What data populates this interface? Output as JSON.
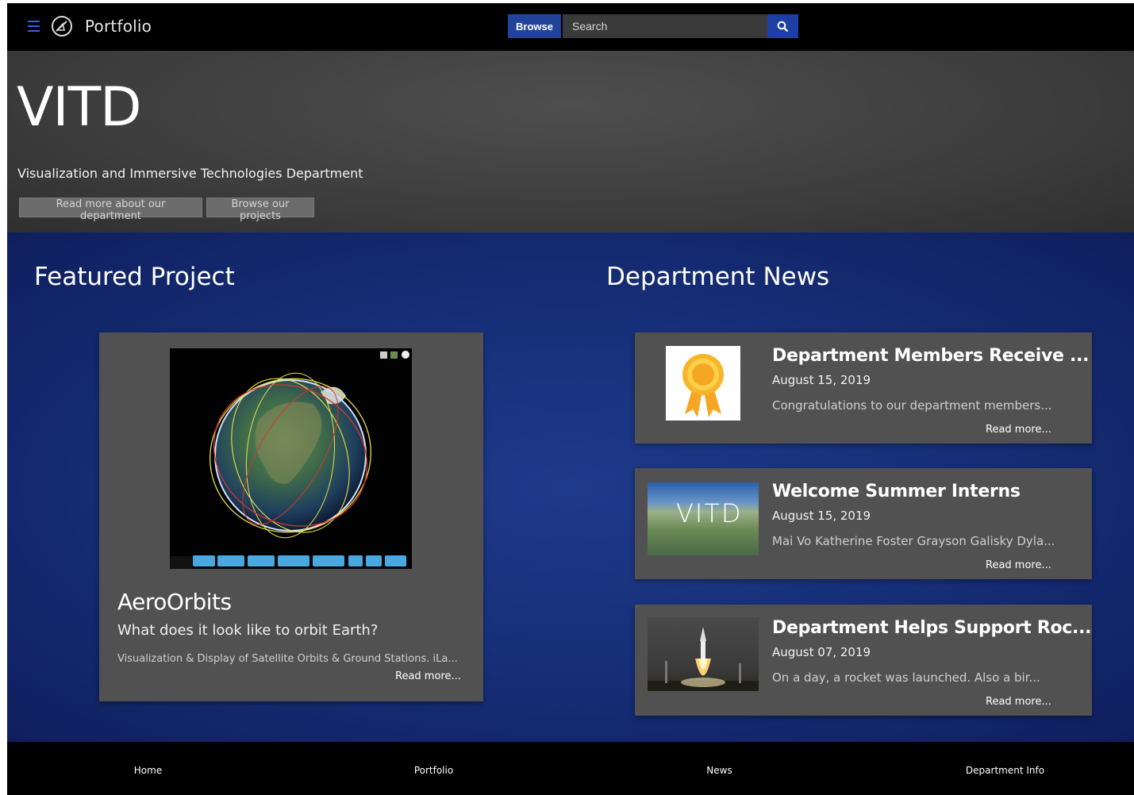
{
  "topbar": {
    "brand": "Portfolio",
    "browse_label": "Browse",
    "search_placeholder": "Search"
  },
  "hero": {
    "title": "VITD",
    "subtitle": "Visualization and Immersive Technologies Department",
    "buttons": [
      "Read more about our department",
      "Browse our projects"
    ]
  },
  "featured": {
    "heading": "Featured Project",
    "name": "AeroOrbits",
    "question": "What does it look like to orbit Earth?",
    "description": "Visualization & Display of Satellite Orbits & Ground Stations. iLa...",
    "read_more": "Read more...",
    "app_toolbar": [
      "Reset",
      "Untrack",
      "Go To ▾",
      "Filter By ▾",
      "Find Sat ▾",
      "1x",
      "60x",
      "600x"
    ]
  },
  "news": {
    "heading": "Department News",
    "items": [
      {
        "title": "Department Members Receive ...",
        "date": "August 15, 2019",
        "excerpt": "Congratulations to our department members...",
        "read_more": "Read more..."
      },
      {
        "title": "Welcome Summer Interns",
        "date": "August 15, 2019",
        "excerpt": "Mai Vo Katherine Foster Grayson Galisky Dyla...",
        "read_more": "Read more...",
        "thumb_text": "VITD"
      },
      {
        "title": "Department Helps Support Roc...",
        "date": "August 07, 2019",
        "excerpt": "On a day, a rocket was launched. Also a bir...",
        "read_more": "Read more..."
      }
    ]
  },
  "footer": {
    "links": [
      "Home",
      "Portfolio",
      "News",
      "Department Info"
    ]
  },
  "colors": {
    "accent": "#22439a",
    "hamburger": "#3a5fd9",
    "card": "#515151",
    "main_bg": "#17307a"
  },
  "icons": [
    "hamburger-icon",
    "brand-logo-icon",
    "search-icon",
    "award-ribbon-icon"
  ]
}
